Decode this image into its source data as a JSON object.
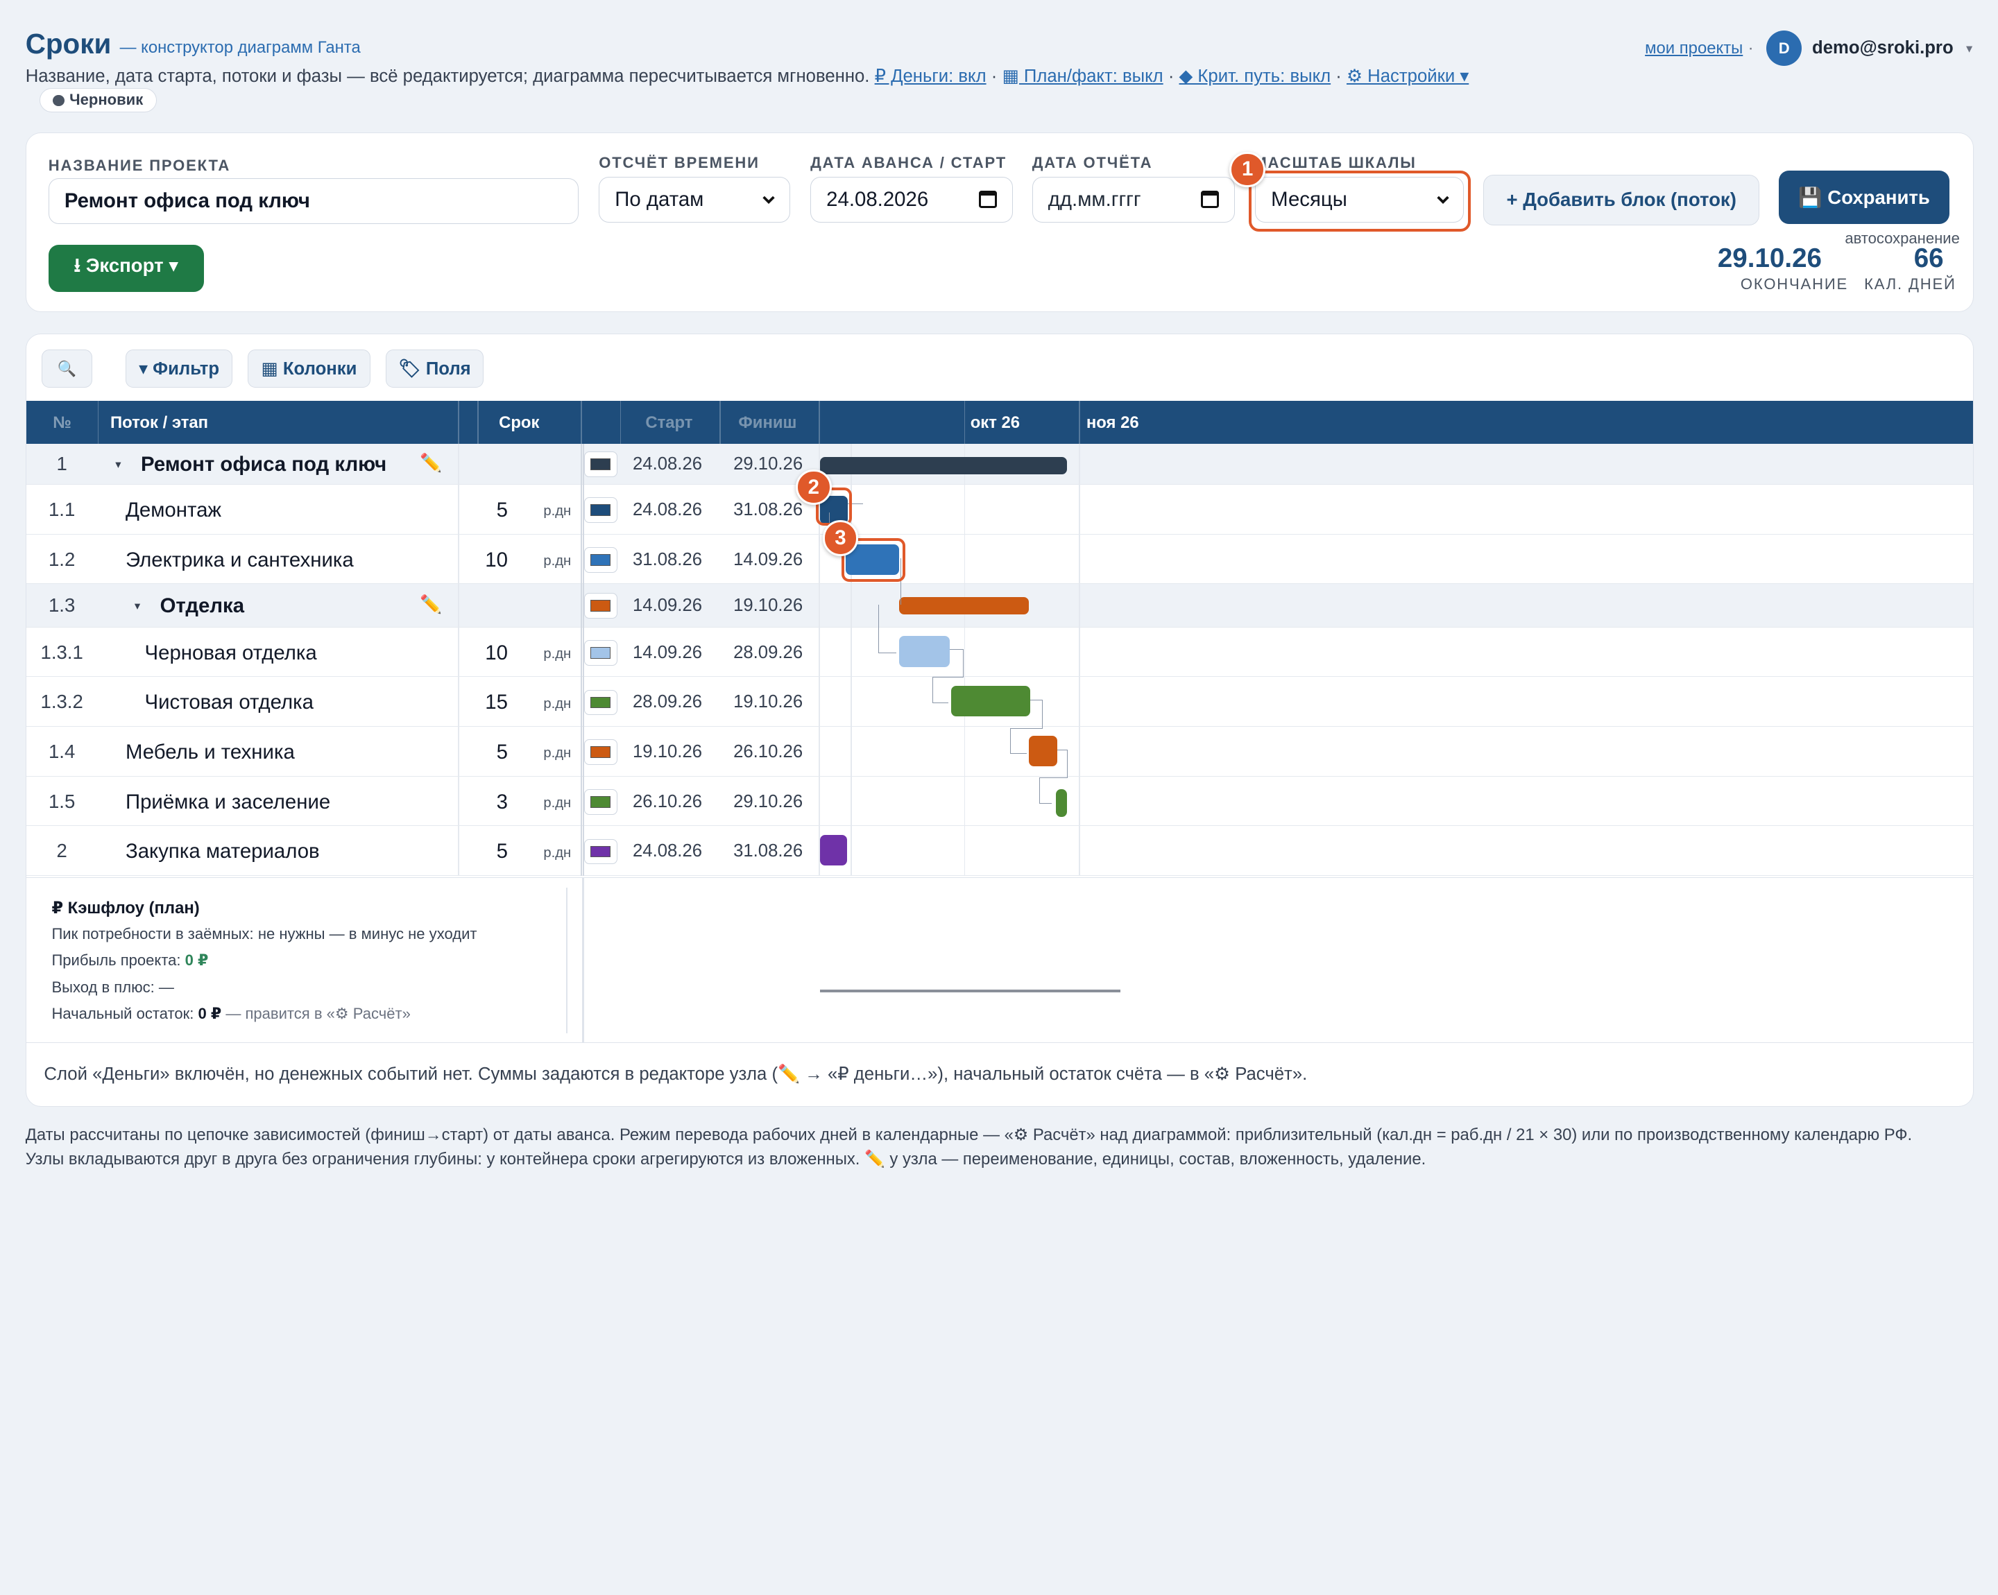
{
  "app": {
    "title": "Сроки",
    "subtitle": "— конструктор диаграмм Ганта",
    "description": "Название, дата старта, потоки и фазы — всё редактируется; диаграмма пересчитывается мгновенно.",
    "toggles": [
      "₽ Деньги: вкл",
      "▦ План/факт: выкл",
      "◆ Крит. путь: выкл",
      "⚙ Настройки ▾"
    ],
    "status_chip": "Черновик"
  },
  "user": {
    "my_projects": "мои проекты",
    "sep": "·",
    "avatar_letter": "D",
    "email": "demo@sroki.pro",
    "menu_caret": "▾"
  },
  "form": {
    "project_name_label": "НАЗВАНИЕ ПРОЕКТА",
    "project_name": "Ремонт офиса под ключ",
    "time_mode_label": "ОТСЧЁТ ВРЕМЕНИ",
    "time_mode": "По датам",
    "start_label": "ДАТА АВАНСА / СТАРТ",
    "start_date": "24.08.2026",
    "report_label": "ДАТА ОТЧЁТА",
    "report_placeholder": "дд.мм.гггг",
    "scale_label": "МАСШТАБ ШКАЛЫ",
    "scale": "Месяцы",
    "add_block": "+ Добавить блок (поток)",
    "save": "💾 Сохранить",
    "export": "⭳ Экспорт ▾",
    "autosave": "автосохранение"
  },
  "summary": {
    "end_value": "29.10.26",
    "end_label": "ОКОНЧАНИЕ",
    "days_value": "66",
    "days_label": "КАЛ. ДНЕЙ"
  },
  "markers": [
    "1",
    "2",
    "3"
  ],
  "toolbar": {
    "search_icon": "🔍",
    "filter": "▾ Фильтр",
    "columns": "▦ Колонки",
    "fields": "🏷 Поля"
  },
  "table": {
    "headers": {
      "num": "№",
      "name": "Поток / этап",
      "duration": "Срок",
      "start": "Старт",
      "finish": "Финиш",
      "oct": "окт 26",
      "nov": "ноя 26"
    },
    "rows": [
      {
        "num": "1",
        "name": "Ремонт офиса под ключ",
        "duration": "",
        "unit": "",
        "color": "#2d3e50",
        "start": "24.08.26",
        "finish": "29.10.26",
        "pencil": "✏️",
        "caret": "▾"
      },
      {
        "num": "1.1",
        "name": "Демонтаж",
        "duration": "5",
        "unit": "р.дн",
        "color": "#1e4d7b",
        "start": "24.08.26",
        "finish": "31.08.26",
        "pencil": "",
        "caret": ""
      },
      {
        "num": "1.2",
        "name": "Электрика и сантехника",
        "duration": "10",
        "unit": "р.дн",
        "color": "#2f73b8",
        "start": "31.08.26",
        "finish": "14.09.26",
        "pencil": "",
        "caret": ""
      },
      {
        "num": "1.3",
        "name": "Отделка",
        "duration": "",
        "unit": "",
        "color": "#cc5a12",
        "start": "14.09.26",
        "finish": "19.10.26",
        "pencil": "✏️",
        "caret": "▾"
      },
      {
        "num": "1.3.1",
        "name": "Черновая отделка",
        "duration": "10",
        "unit": "р.дн",
        "color": "#a3c4e8",
        "start": "14.09.26",
        "finish": "28.09.26",
        "pencil": "",
        "caret": ""
      },
      {
        "num": "1.3.2",
        "name": "Чистовая отделка",
        "duration": "15",
        "unit": "р.дн",
        "color": "#4e8a33",
        "start": "28.09.26",
        "finish": "19.10.26",
        "pencil": "",
        "caret": ""
      },
      {
        "num": "1.4",
        "name": "Мебель и техника",
        "duration": "5",
        "unit": "р.дн",
        "color": "#cc5a12",
        "start": "19.10.26",
        "finish": "26.10.26",
        "pencil": "",
        "caret": ""
      },
      {
        "num": "1.5",
        "name": "Приёмка и заселение",
        "duration": "3",
        "unit": "р.дн",
        "color": "#4e8a33",
        "start": "26.10.26",
        "finish": "29.10.26",
        "pencil": "",
        "caret": ""
      },
      {
        "num": "2",
        "name": "Закупка материалов",
        "duration": "5",
        "unit": "р.дн",
        "color": "#6f32a8",
        "start": "24.08.26",
        "finish": "31.08.26",
        "pencil": "",
        "caret": ""
      }
    ]
  },
  "cashflow": {
    "title": "₽ Кэшфлоу (план)",
    "peak_label": "Пик потребности в заёмных:",
    "peak_value": "не нужны — в минус не уходит",
    "profit_label": "Прибыль проекта:",
    "profit_value": "0 ₽",
    "breakeven_label": "Выход в плюс:",
    "breakeven_value": "—",
    "balance_label": "Начальный остаток:",
    "balance_value": "0 ₽",
    "balance_note": "— правится в «⚙ Расчёт»"
  },
  "money_note": "Слой «Деньги» включён, но денежных событий нет. Суммы задаются в редакторе узла (✏️ → «₽ деньги…»), начальный остаток счёта — в «⚙ Расчёт».",
  "bottom_note": "Даты рассчитаны по цепочке зависимостей (финиш→старт) от даты аванса. Режим перевода рабочих дней в календарные — «⚙ Расчёт» над диаграммой: приблизительный (кал.дн = раб.дн / 21 × 30) или по производственному календарю РФ. Узлы вкладываются друг в друга без ограничения глубины: у контейнера сроки агрегируются из вложенных. ✏️ у узла — переименование, единицы, состав, вложенность, удаление."
}
